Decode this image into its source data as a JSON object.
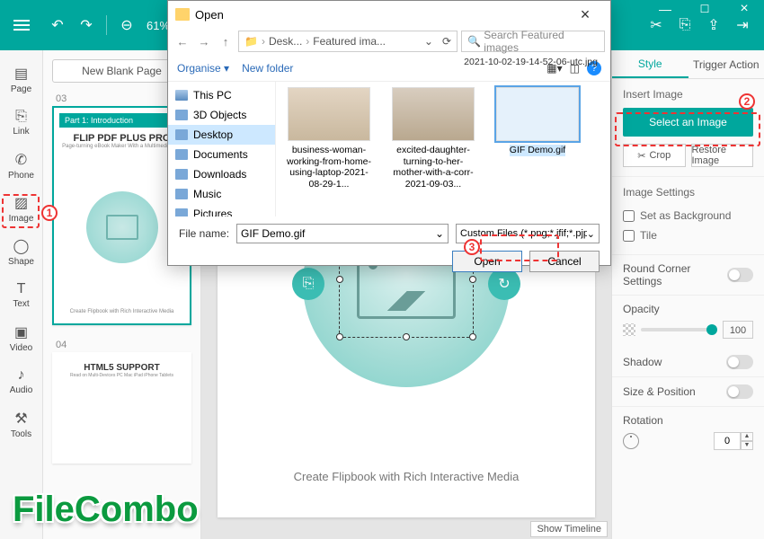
{
  "topbar": {
    "zoom": "61%"
  },
  "left_tools": [
    {
      "key": "page",
      "label": "Page"
    },
    {
      "key": "link",
      "label": "Link"
    },
    {
      "key": "phone",
      "label": "Phone"
    },
    {
      "key": "image",
      "label": "Image"
    },
    {
      "key": "shape",
      "label": "Shape"
    },
    {
      "key": "text",
      "label": "Text"
    },
    {
      "key": "video",
      "label": "Video"
    },
    {
      "key": "audio",
      "label": "Audio"
    },
    {
      "key": "tools",
      "label": "Tools"
    }
  ],
  "pages": {
    "new_blank": "New Blank Page",
    "page_a_num": "03",
    "page_b_num": "04",
    "thumb_a": {
      "banner": "Part 1: Introduction",
      "title": "FLIP PDF PLUS PRO",
      "subtitle": "Page-turning eBook Maker With a Multimedia Edit",
      "caption": "Create Flipbook with Rich Interactive Media"
    },
    "thumb_b": {
      "title": "HTML5 SUPPORT",
      "subtitle": "Read on Multi-Devices PC Mac iPad iPhone Tablets"
    }
  },
  "canvas": {
    "caption": "Create Flipbook with Rich Interactive Media",
    "show_timeline": "Show Timeline"
  },
  "right": {
    "tabs": {
      "style": "Style",
      "trigger": "Trigger Action"
    },
    "insert_image": "Insert Image",
    "select_image_btn": "Select an Image",
    "crop": "Crop",
    "restore": "Restore Image",
    "image_settings": "Image Settings",
    "set_bg": "Set as Background",
    "tile": "Tile",
    "round_corner": "Round Corner Settings",
    "opacity_label": "Opacity",
    "opacity_val": "100",
    "shadow": "Shadow",
    "size_pos": "Size & Position",
    "rotation": "Rotation",
    "rotation_val": "0"
  },
  "dialog": {
    "title": "Open",
    "breadcrumb": {
      "a": "Desk...",
      "b": "Featured ima..."
    },
    "search_placeholder": "Search Featured images",
    "organise": "Organise",
    "new_folder": "New folder",
    "tree": [
      {
        "label": "This PC",
        "kind": "pc"
      },
      {
        "label": "3D Objects"
      },
      {
        "label": "Desktop",
        "selected": true
      },
      {
        "label": "Documents"
      },
      {
        "label": "Downloads"
      },
      {
        "label": "Music"
      },
      {
        "label": "Pictures"
      }
    ],
    "truncated_file": "2021-10-02-19-14-52-06-utc.jpg",
    "files": [
      {
        "label": "business-woman-working-from-home-using-laptop-2021-08-29-1..."
      },
      {
        "label": "excited-daughter-turning-to-her-mother-with-a-corr-2021-09-03..."
      },
      {
        "label": "GIF Demo.gif",
        "selected": true
      }
    ],
    "file_name_label": "File name:",
    "file_name_value": "GIF Demo.gif",
    "file_type": "Custom Files (*.png;*.jfif;*.pjpe",
    "open_btn": "Open",
    "cancel_btn": "Cancel"
  },
  "callouts": {
    "c1": "1",
    "c2": "2",
    "c3": "3"
  },
  "watermark": "FileCombo"
}
